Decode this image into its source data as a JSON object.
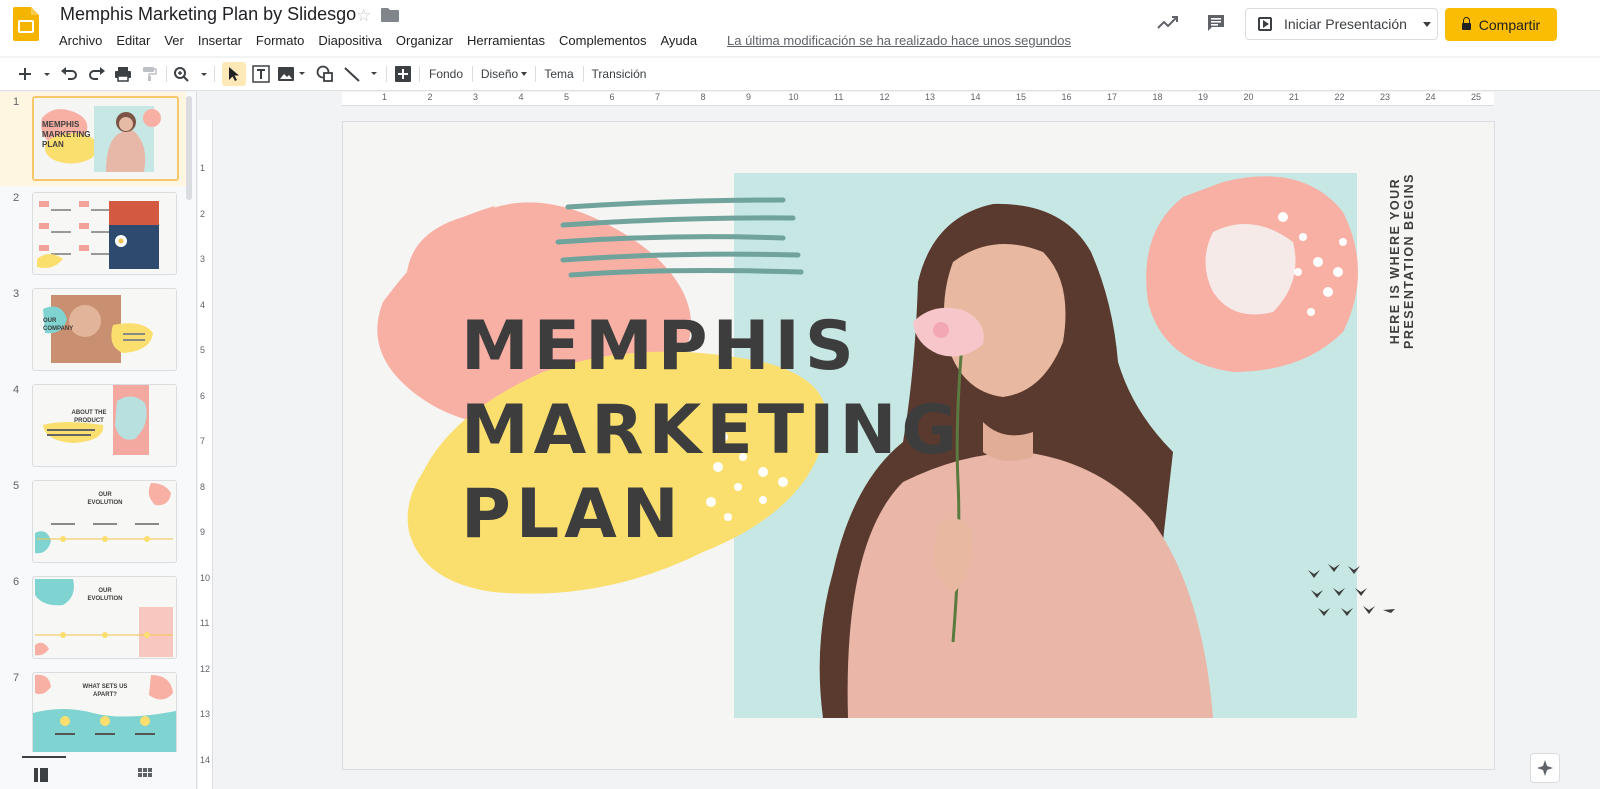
{
  "app": {
    "doc_title": "Memphis Marketing Plan by Slidesgo",
    "menu": [
      "Archivo",
      "Editar",
      "Ver",
      "Insertar",
      "Formato",
      "Diapositiva",
      "Organizar",
      "Herramientas",
      "Complementos",
      "Ayuda"
    ],
    "last_edit": "La última modificación se ha realizado hace unos segundos",
    "present_label": "Iniciar Presentación",
    "share_label": "Compartir"
  },
  "toolbar": {
    "background_label": "Fondo",
    "layout_label": "Diseño",
    "theme_label": "Tema",
    "transition_label": "Transición"
  },
  "ruler": {
    "h_ticks": [
      "1",
      "2",
      "3",
      "4",
      "5",
      "6",
      "7",
      "8",
      "9",
      "10",
      "11",
      "12",
      "13",
      "14",
      "15",
      "16",
      "17",
      "18",
      "19",
      "20",
      "21",
      "22",
      "23",
      "24",
      "25"
    ],
    "v_ticks": [
      "1",
      "2",
      "3",
      "4",
      "5",
      "6",
      "7",
      "8",
      "9",
      "10",
      "11",
      "12",
      "13",
      "14"
    ]
  },
  "slides": [
    {
      "num": "1",
      "title": "MEMPHIS MARKETING PLAN",
      "selected": true
    },
    {
      "num": "2",
      "title": ""
    },
    {
      "num": "3",
      "title": "OUR COMPANY"
    },
    {
      "num": "4",
      "title": "ABOUT THE PRODUCT"
    },
    {
      "num": "5",
      "title": "OUR EVOLUTION"
    },
    {
      "num": "6",
      "title": "OUR EVOLUTION"
    },
    {
      "num": "7",
      "title": "WHAT SETS US APART?"
    }
  ],
  "current_slide": {
    "title": "MEMPHIS\nMARKETING\nPLAN",
    "vertical_text": "HERE IS WHERE YOUR PRESENTATION BEGINS"
  },
  "colors": {
    "accent_yellow": "#fbbc04",
    "salmon": "#f8b0a5",
    "yellow": "#fbdf6e",
    "mint": "#c6e7e3",
    "teal_stroke": "#6fa39b",
    "title_text": "#3d3d3d"
  }
}
